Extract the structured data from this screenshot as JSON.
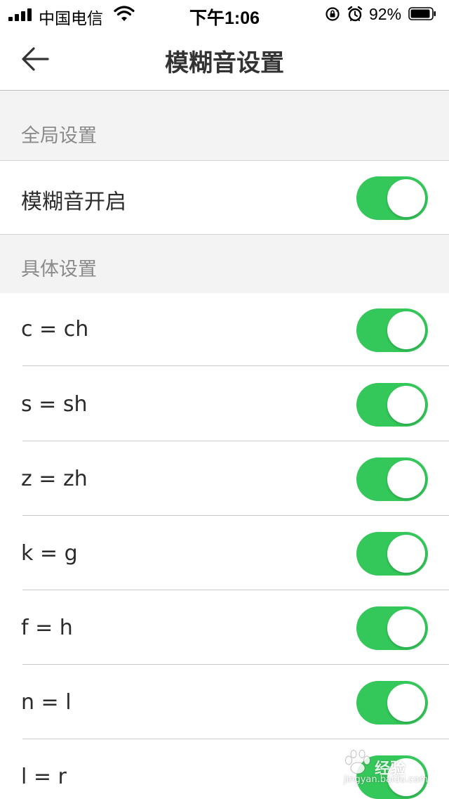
{
  "status_bar": {
    "carrier": "中国电信",
    "time": "下午1:06",
    "battery_percent": "92%",
    "battery_level": 0.92,
    "icons": [
      "signal-icon",
      "wifi-icon",
      "rotation-lock-icon",
      "alarm-icon",
      "battery-icon"
    ]
  },
  "nav": {
    "title": "模糊音设置",
    "back_icon": "back-arrow-icon"
  },
  "sections": {
    "global": {
      "header": "全局设置",
      "items": [
        {
          "label": "模糊音开启",
          "enabled": true
        }
      ]
    },
    "specific": {
      "header": "具体设置",
      "items": [
        {
          "label": "c = ch",
          "enabled": true
        },
        {
          "label": "s = sh",
          "enabled": true
        },
        {
          "label": "z = zh",
          "enabled": true
        },
        {
          "label": "k = g",
          "enabled": true
        },
        {
          "label": "f = h",
          "enabled": true
        },
        {
          "label": "n = l",
          "enabled": true
        },
        {
          "label": "l = r",
          "enabled": true
        }
      ]
    }
  },
  "colors": {
    "toggle_on": "#34c759",
    "section_bg": "#f3f3f3"
  },
  "watermark": {
    "text": "经验",
    "url": "jingyan.baidu.com"
  }
}
